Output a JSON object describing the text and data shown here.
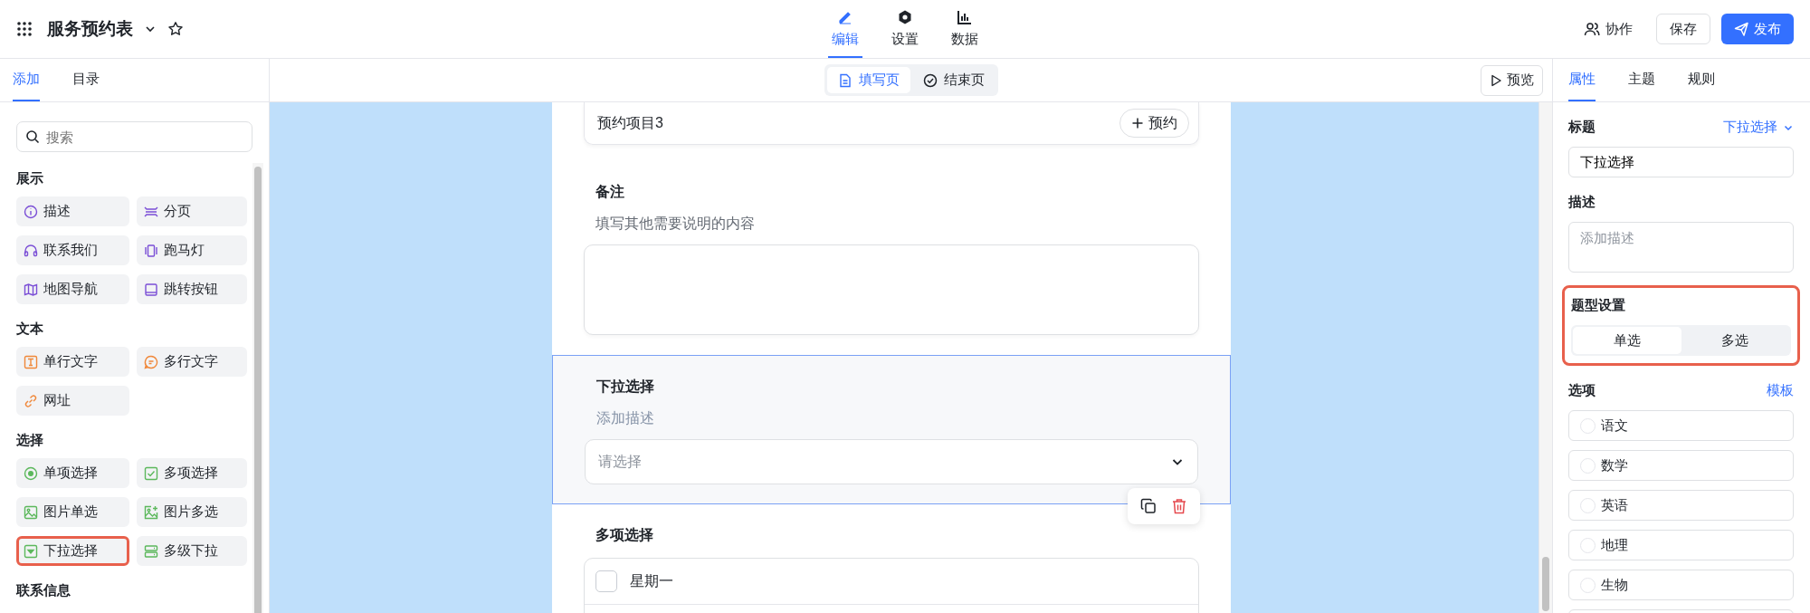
{
  "header": {
    "title": "服务预约表",
    "nav": [
      {
        "label": "编辑",
        "selected": true
      },
      {
        "label": "设置",
        "selected": false
      },
      {
        "label": "数据",
        "selected": false
      }
    ],
    "actions": [
      {
        "label": "协作",
        "kind": "plain"
      },
      {
        "label": "保存",
        "kind": "outline"
      },
      {
        "label": "发布",
        "kind": "primary"
      }
    ]
  },
  "left_panel": {
    "tabs": [
      {
        "label": "添加",
        "selected": true
      },
      {
        "label": "目录",
        "selected": false
      }
    ],
    "search": {
      "placeholder": "搜索"
    },
    "groups": [
      {
        "title": "展示",
        "items": [
          {
            "label": "描述",
            "highlighted": false
          },
          {
            "label": "分页",
            "highlighted": false
          },
          {
            "label": "联系我们",
            "highlighted": false
          },
          {
            "label": "跑马灯",
            "highlighted": false
          },
          {
            "label": "地图导航",
            "highlighted": false
          },
          {
            "label": "跳转按钮",
            "highlighted": false
          }
        ]
      },
      {
        "title": "文本",
        "items": [
          {
            "label": "单行文字",
            "highlighted": false
          },
          {
            "label": "多行文字",
            "highlighted": false
          },
          {
            "label": "网址",
            "highlighted": false
          }
        ]
      },
      {
        "title": "选择",
        "items": [
          {
            "label": "单项选择",
            "highlighted": false
          },
          {
            "label": "多项选择",
            "highlighted": false
          },
          {
            "label": "图片单选",
            "highlighted": false
          },
          {
            "label": "图片多选",
            "highlighted": false
          },
          {
            "label": "下拉选择",
            "highlighted": true
          },
          {
            "label": "多级下拉",
            "highlighted": false
          }
        ]
      },
      {
        "title": "联系信息"
      }
    ]
  },
  "canvas": {
    "page_tabs": [
      {
        "label": "填写页",
        "selected": true
      },
      {
        "label": "结束页",
        "selected": false
      }
    ],
    "preview": "预览",
    "fields": [
      {
        "kind": "booking",
        "item": "预约项目3",
        "button": "预约",
        "selected": false
      },
      {
        "kind": "textarea",
        "title": "备注",
        "description": "填写其他需要说明的内容",
        "selected": false
      },
      {
        "kind": "dropdown",
        "title": "下拉选择",
        "description": "添加描述",
        "placeholder": "请选择",
        "selected": true
      },
      {
        "kind": "checkbox",
        "title": "多项选择",
        "selected": false,
        "options": [
          {
            "label": "星期一",
            "checked": false
          }
        ]
      }
    ]
  },
  "right_panel": {
    "tabs": [
      {
        "label": "属性",
        "selected": true
      },
      {
        "label": "主题",
        "selected": false
      },
      {
        "label": "规则",
        "selected": false
      }
    ],
    "title_label": "标题",
    "type_picker": "下拉选择",
    "title_value": "下拉选择",
    "description_label": "描述",
    "description_placeholder": "添加描述",
    "type_settings": {
      "label": "题型设置",
      "highlighted": true,
      "options": [
        {
          "label": "单选",
          "selected": true
        },
        {
          "label": "多选",
          "selected": false
        }
      ]
    },
    "options_label": "选项",
    "template_link": "模板",
    "options": [
      {
        "label": "语文",
        "selected": false
      },
      {
        "label": "数学",
        "selected": false
      },
      {
        "label": "英语",
        "selected": false
      },
      {
        "label": "地理",
        "selected": false
      },
      {
        "label": "生物",
        "selected": false
      }
    ]
  }
}
